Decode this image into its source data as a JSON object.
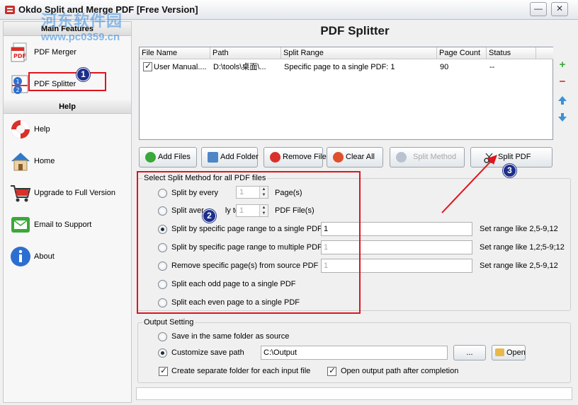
{
  "window": {
    "title": "Okdo Split and Merge PDF [Free Version]",
    "minimize_glyph": "—",
    "close_glyph": "✕"
  },
  "watermark": {
    "line1": "河东软件园",
    "line2": "www.pc0359.cn"
  },
  "sidebar": {
    "main_features_heading": "Main Features",
    "help_heading": "Help",
    "features": [
      {
        "label": "PDF Merger",
        "icon": "pdf-merger-icon"
      },
      {
        "label": "PDF Splitter",
        "icon": "pdf-splitter-icon"
      }
    ],
    "help_items": [
      {
        "label": "Help",
        "icon": "lifebuoy-icon"
      },
      {
        "label": "Home",
        "icon": "home-icon"
      },
      {
        "label": "Upgrade to Full Version",
        "icon": "shopping-cart-icon"
      },
      {
        "label": "Email to Support",
        "icon": "email-icon"
      },
      {
        "label": "About",
        "icon": "info-icon"
      }
    ]
  },
  "main": {
    "title": "PDF Splitter",
    "table": {
      "columns": [
        "File Name",
        "Path",
        "Split Range",
        "Page Count",
        "Status"
      ],
      "rows": [
        {
          "checked": true,
          "file_name": "User Manual....",
          "path": "D:\\tools\\桌面\\...",
          "split_range": "Specific page to a single PDF: 1",
          "page_count": "90",
          "status": "--"
        }
      ]
    },
    "toolbar": {
      "add_files": "Add Files",
      "add_folder": "Add Folder",
      "remove_file": "Remove File",
      "clear_all": "Clear All",
      "split_method": "Split Method",
      "split_pdf": "Split PDF"
    },
    "split_method": {
      "heading": "Select Split Method for all PDF files",
      "options": [
        {
          "label": "Split by every",
          "suffix": "Page(s)",
          "spin_value": "1",
          "selected": false
        },
        {
          "label": "Split averagely to",
          "visible_label_start": "Split aver",
          "visible_label_end": "ly to",
          "suffix": "PDF File(s)",
          "spin_value": "1",
          "selected": false
        },
        {
          "label": "Split by specific page range to a single PDF",
          "field_value": "1",
          "hint": "Set range like 2,5-9,12",
          "selected": true
        },
        {
          "label": "Split by specific page range to multiple PDF",
          "field_value": "1",
          "hint": "Set range like 1,2;5-9;12",
          "selected": false
        },
        {
          "label": "Remove specific page(s) from source PDF",
          "field_value": "1",
          "hint": "Set range like 2,5-9,12",
          "selected": false
        },
        {
          "label": "Split each odd page to a single PDF",
          "selected": false
        },
        {
          "label": "Split each even page to a single PDF",
          "selected": false
        }
      ]
    },
    "output": {
      "heading": "Output Setting",
      "same_folder_label": "Save in the same folder as source",
      "custom_path_label": "Customize save path",
      "custom_path_value": "C:\\Output",
      "browse_label": "...",
      "open_label": "Open",
      "separate_folder_label": "Create separate folder for each input file",
      "open_after_label": "Open output path after completion",
      "separate_folder_checked": true,
      "open_after_checked": true
    }
  },
  "annotations": {
    "badge1": "1",
    "badge2": "2",
    "badge3": "3",
    "color": "#e0141e"
  },
  "colors": {
    "green_plus": "#3aa83a",
    "red_minus": "#d9302a",
    "blue_arrow": "#3d8fd6"
  }
}
